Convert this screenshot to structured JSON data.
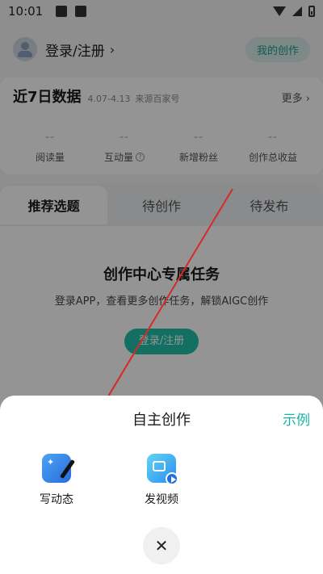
{
  "status_bar": {
    "time": "10:01"
  },
  "top_bar": {
    "login_text": "登录/注册",
    "chevron": "›",
    "my_works": "我的创作"
  },
  "data_card": {
    "title": "近7日数据",
    "range": "4.07-4.13",
    "source": "来源百家号",
    "more": "更多 ›",
    "stats": [
      {
        "value": "--",
        "label": "阅读量"
      },
      {
        "value": "--",
        "label": "互动量"
      },
      {
        "value": "--",
        "label": "新增粉丝"
      },
      {
        "value": "--",
        "label": "创作总收益"
      }
    ]
  },
  "tabs": [
    {
      "label": "推荐选题"
    },
    {
      "label": "待创作"
    },
    {
      "label": "待发布"
    }
  ],
  "empty_state": {
    "title": "创作中心专属任务",
    "description": "登录APP，查看更多创作任务，解锁AIGC创作",
    "button": "登录/注册"
  },
  "sheet": {
    "title": "自主创作",
    "example": "示例",
    "actions": [
      {
        "label": "写动态",
        "icon": "write-post-icon"
      },
      {
        "label": "发视频",
        "icon": "post-video-icon"
      }
    ],
    "close": "✕"
  },
  "colors": {
    "accent": "#1fbfa8",
    "link": "#17b3a2",
    "annotation": "#d62a2a"
  }
}
